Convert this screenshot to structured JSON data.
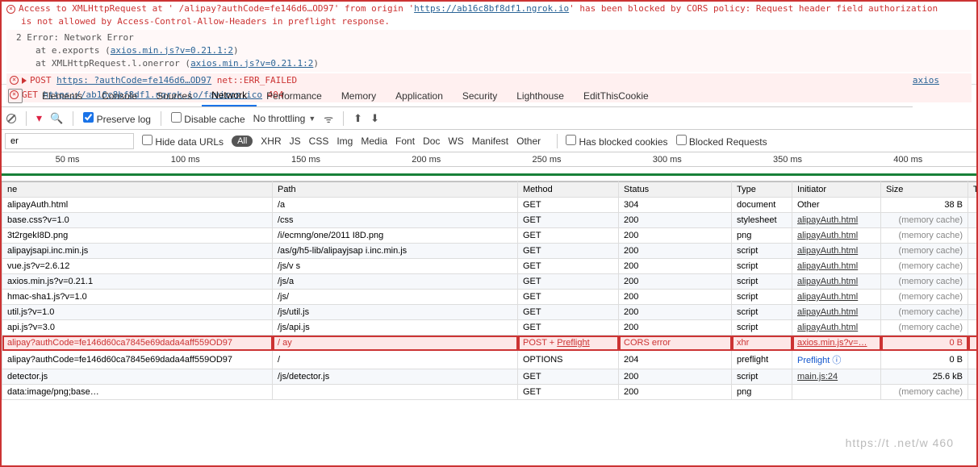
{
  "console": {
    "cors_line1": "Access to XMLHttpRequest at '                                   /alipay?authCode=fe146d6…OD97' from origin '",
    "cors_origin": "https://ab16c8bf8df1.ngrok.io",
    "cors_line1_tail": "' has been blocked by CORS policy: Request header field authorization",
    "cors_line2": "is not allowed by Access-Control-Allow-Headers in preflight response.",
    "neterr_title": "2 Error: Network Error",
    "neterr_stack1_a": "at e.exports (",
    "neterr_stack1_link": "axios.min.js?v=0.21.1:2",
    "neterr_stack2_a": "at XMLHttpRequest.l.onerror (",
    "neterr_stack2_link": "axios.min.js?v=0.21.1:2",
    "post_label": "POST",
    "post_url": "https:                              ?authCode=fe146d6…OD97",
    "post_err": " net::ERR_FAILED",
    "post_right": "axios",
    "get_label": "GET",
    "get_url": "https://ab16c8bf8df1.ngrok.io/favicon.ico",
    "get_status": " 404"
  },
  "tabs": {
    "items": [
      "Elements",
      "Console",
      "Sources",
      "Network",
      "Performance",
      "Memory",
      "Application",
      "Security",
      "Lighthouse",
      "EditThisCookie"
    ],
    "activeIndex": 3
  },
  "toolbar": {
    "preserve_log": "Preserve log",
    "disable_cache": "Disable cache",
    "no_throttling": "No throttling"
  },
  "filterbar": {
    "filter_value": "er",
    "hide_data_urls": "Hide data URLs",
    "all": "All",
    "types": [
      "XHR",
      "JS",
      "CSS",
      "Img",
      "Media",
      "Font",
      "Doc",
      "WS",
      "Manifest",
      "Other"
    ],
    "blocked_cookies": "Has blocked cookies",
    "blocked_requests": "Blocked Requests"
  },
  "timeline": {
    "ticks": [
      "50 ms",
      "100 ms",
      "150 ms",
      "200 ms",
      "250 ms",
      "300 ms",
      "350 ms",
      "400 ms"
    ]
  },
  "grid": {
    "headers": [
      "ne",
      "Path",
      "Method",
      "Status",
      "Type",
      "Initiator",
      "Size",
      "Tim"
    ],
    "rows": [
      {
        "name": "alipayAuth.html",
        "path": "/a",
        "method": "GET",
        "status": "304",
        "type": "document",
        "initiator": "Other",
        "initiator_link": false,
        "size": "38 B",
        "mem": false,
        "error": false
      },
      {
        "name": "base.css?v=1.0",
        "path": "/css",
        "method": "GET",
        "status": "200",
        "type": "stylesheet",
        "initiator": "alipayAuth.html",
        "initiator_link": true,
        "size": "(memory cache)",
        "mem": true,
        "error": false
      },
      {
        "name": "3t2rgekI8D.png",
        "path": "/i/ecmng/one/2011            I8D.png",
        "method": "GET",
        "status": "200",
        "type": "png",
        "initiator": "alipayAuth.html",
        "initiator_link": true,
        "size": "(memory cache)",
        "mem": true,
        "error": false
      },
      {
        "name": "alipayjsapi.inc.min.js",
        "path": "/as/g/h5-lib/alipayjsap            i.inc.min.js",
        "method": "GET",
        "status": "200",
        "type": "script",
        "initiator": "alipayAuth.html",
        "initiator_link": true,
        "size": "(memory cache)",
        "mem": true,
        "error": false
      },
      {
        "name": "vue.js?v=2.6.12",
        "path": "/js/v    s",
        "method": "GET",
        "status": "200",
        "type": "script",
        "initiator": "alipayAuth.html",
        "initiator_link": true,
        "size": "(memory cache)",
        "mem": true,
        "error": false
      },
      {
        "name": "axios.min.js?v=0.21.1",
        "path": "/js/a",
        "method": "GET",
        "status": "200",
        "type": "script",
        "initiator": "alipayAuth.html",
        "initiator_link": true,
        "size": "(memory cache)",
        "mem": true,
        "error": false
      },
      {
        "name": "hmac-sha1.js?v=1.0",
        "path": "/js/",
        "method": "GET",
        "status": "200",
        "type": "script",
        "initiator": "alipayAuth.html",
        "initiator_link": true,
        "size": "(memory cache)",
        "mem": true,
        "error": false
      },
      {
        "name": "util.js?v=1.0",
        "path": "/js/util.js",
        "method": "GET",
        "status": "200",
        "type": "script",
        "initiator": "alipayAuth.html",
        "initiator_link": true,
        "size": "(memory cache)",
        "mem": true,
        "error": false
      },
      {
        "name": "api.js?v=3.0",
        "path": "/js/api.js",
        "method": "GET",
        "status": "200",
        "type": "script",
        "initiator": "alipayAuth.html",
        "initiator_link": true,
        "size": "(memory cache)",
        "mem": true,
        "error": false
      },
      {
        "name": "alipay?authCode=fe146d60ca7845e69dada4aff559OD97",
        "path": "/            ay",
        "method": "POST + Preflight",
        "status": "CORS error",
        "type": "xhr",
        "initiator": "axios.min.js?v=…",
        "initiator_link": true,
        "size": "0 B",
        "mem": false,
        "error": true,
        "preflight_link": true
      },
      {
        "name": "alipay?authCode=fe146d60ca7845e69dada4aff559OD97",
        "path": "/",
        "method": "OPTIONS",
        "status": "204",
        "type": "preflight",
        "initiator": "Preflight ⓘ",
        "initiator_link": false,
        "size": "0 B",
        "mem": false,
        "error": false
      },
      {
        "name": "detector.js",
        "path": "/js/detector.js",
        "method": "GET",
        "status": "200",
        "type": "script",
        "initiator": "main.js:24",
        "initiator_link": true,
        "size": "25.6 kB",
        "mem": false,
        "error": false
      },
      {
        "name": "data:image/png;base…",
        "path": "",
        "method": "GET",
        "status": "200",
        "type": "png",
        "initiator": "",
        "initiator_link": false,
        "size": "(memory cache)",
        "mem": true,
        "error": false
      }
    ]
  },
  "watermark": "https://t            .net/w         460"
}
